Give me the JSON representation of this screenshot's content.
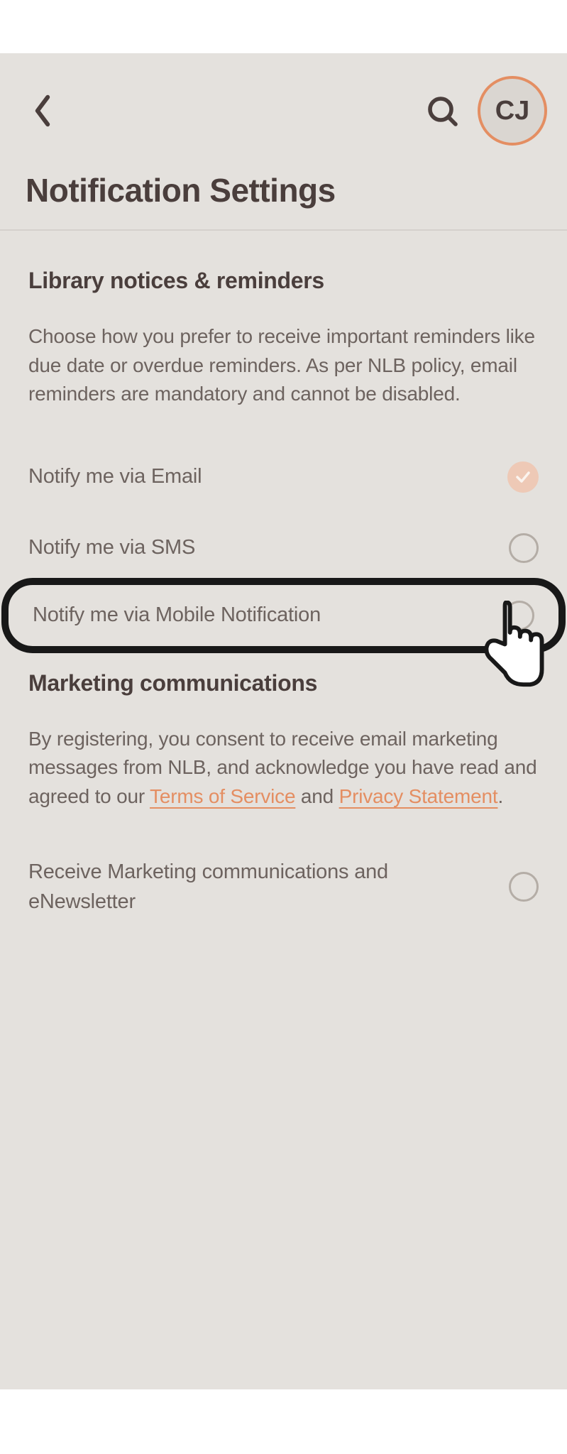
{
  "header": {
    "avatar_initials": "CJ"
  },
  "page_title": "Notification Settings",
  "section1": {
    "title": "Library notices & reminders",
    "body": "Choose how you prefer to receive important reminders like due date or overdue reminders. As per NLB policy, email reminders are mandatory and cannot be disabled.",
    "opt_email": "Notify me via Email",
    "opt_sms": "Notify me via SMS",
    "opt_mobile": "Notify me via Mobile Notification"
  },
  "section2": {
    "title": "Marketing communications",
    "body_pre": "By registering, you consent to receive email marketing messages from NLB, and acknowledge you have read and agreed to our ",
    "terms": "Terms of Service",
    "and": " and ",
    "privacy": "Privacy Statement",
    "period": ".",
    "opt_marketing": "Receive Marketing communications and eNewsletter"
  }
}
